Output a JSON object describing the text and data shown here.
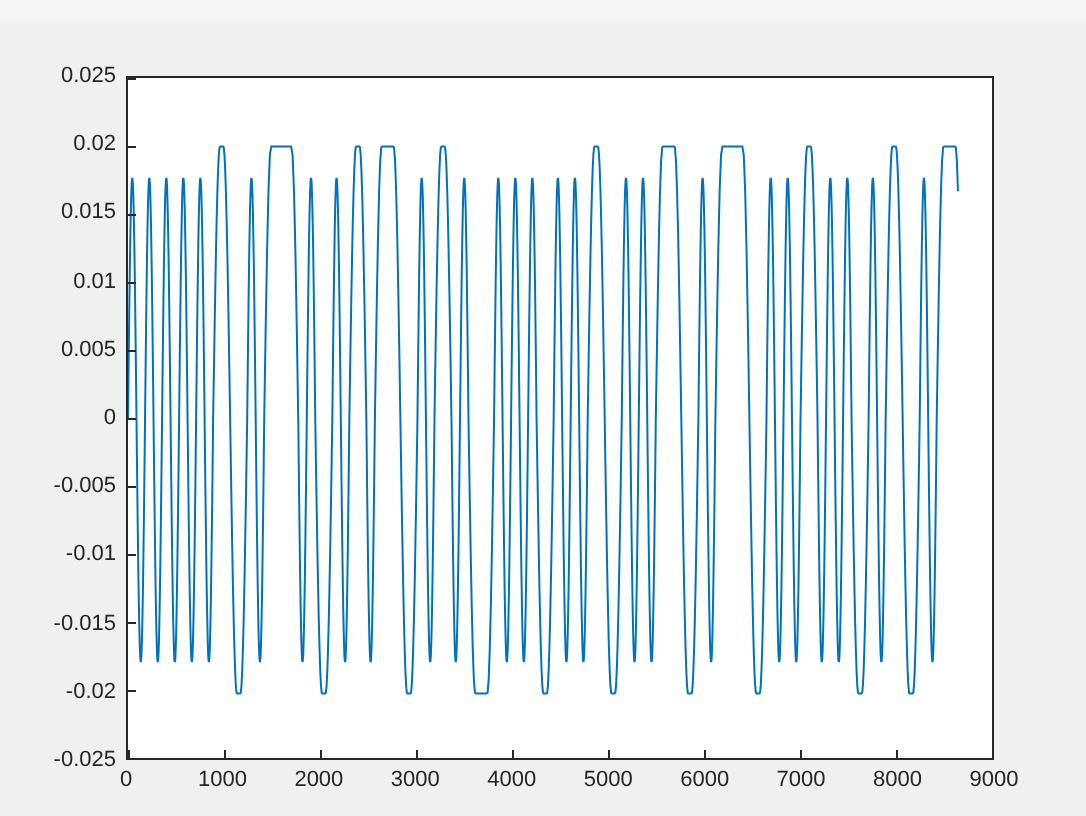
{
  "figure": {
    "axes": {
      "yticks": [
        "0.025",
        "0.02",
        "0.015",
        "0.01",
        "0.005",
        "0",
        "-0.005",
        "-0.01",
        "-0.015",
        "-0.02",
        "-0.025"
      ],
      "xticks": [
        "0",
        "1000",
        "2000",
        "3000",
        "4000",
        "5000",
        "6000",
        "7000",
        "8000",
        "9000"
      ]
    }
  }
}
